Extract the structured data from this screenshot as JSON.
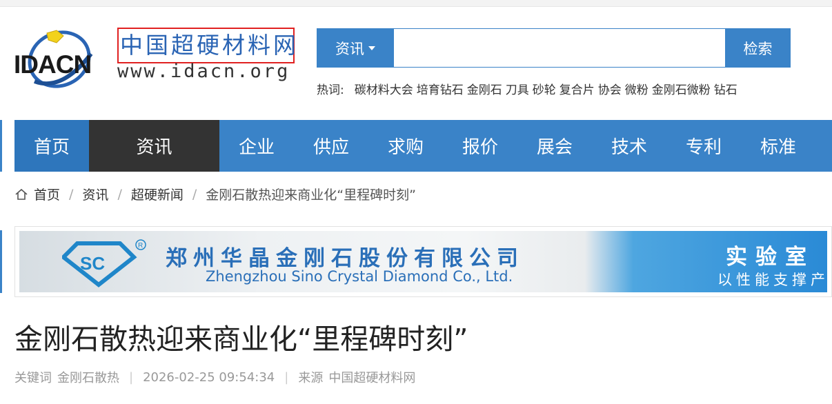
{
  "logo": {
    "brand": "IDACN",
    "title_cn": "中国超硬材料网",
    "url": "www.idacn.org"
  },
  "search": {
    "category": "资讯",
    "placeholder": "",
    "button": "检索"
  },
  "hotwords": {
    "label": "热词:",
    "items": [
      "碳材料大会",
      "培育钻石",
      "金刚石",
      "刀具",
      "砂轮",
      "复合片",
      "协会",
      "微粉",
      "金刚石微粉",
      "钻石"
    ]
  },
  "nav": {
    "home": "首页",
    "active": "资讯",
    "items": [
      "企业",
      "供应",
      "求购",
      "报价",
      "展会",
      "技术",
      "专利",
      "标准"
    ]
  },
  "breadcrumb": {
    "items": [
      "首页",
      "资讯",
      "超硬新闻"
    ],
    "current": "金刚石散热迎来商业化“里程碑时刻”"
  },
  "banner": {
    "company_cn": "郑州华晶金刚石股份有限公司",
    "company_en": "Zhengzhou Sino Crystal Diamond Co., Ltd.",
    "right_title": "实验室",
    "right_sub": "以性能支撑产"
  },
  "article": {
    "title": "金刚石散热迎来商业化“里程碑时刻”",
    "keyword_label": "关键词",
    "keyword": "金刚石散热",
    "date": "2026-02-25 09:54:34",
    "source_label": "来源",
    "source": "中国超硬材料网"
  },
  "colors": {
    "primary": "#3a83c8",
    "active_nav": "#333333",
    "logo_box": "#e02020"
  }
}
